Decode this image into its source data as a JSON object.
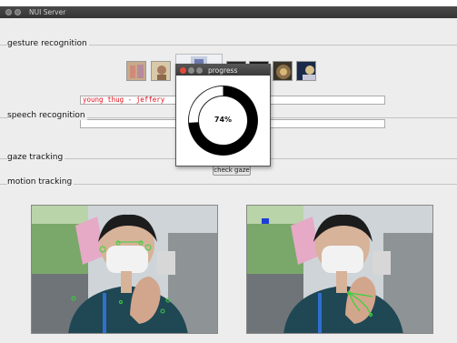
{
  "window": {
    "title": "NUI Server"
  },
  "sections": {
    "gesture": "gesture recognition",
    "speech": "speech recognition",
    "gaze": "gaze tracking",
    "motion": "motion tracking"
  },
  "speech": {
    "field1_value": "young thug - jeffery",
    "field2_value": ""
  },
  "gaze": {
    "button_label": "check gaze"
  },
  "dialog": {
    "title": "progress",
    "percent_text": "74%",
    "progress": 0.74
  },
  "colors": {
    "accent_text": "#e0101e",
    "progress_ring": "#000000",
    "tracking_marker": "#39d23c"
  },
  "icons": {
    "close": "close-icon",
    "minimize": "minimize-icon",
    "maximize": "maximize-icon"
  }
}
